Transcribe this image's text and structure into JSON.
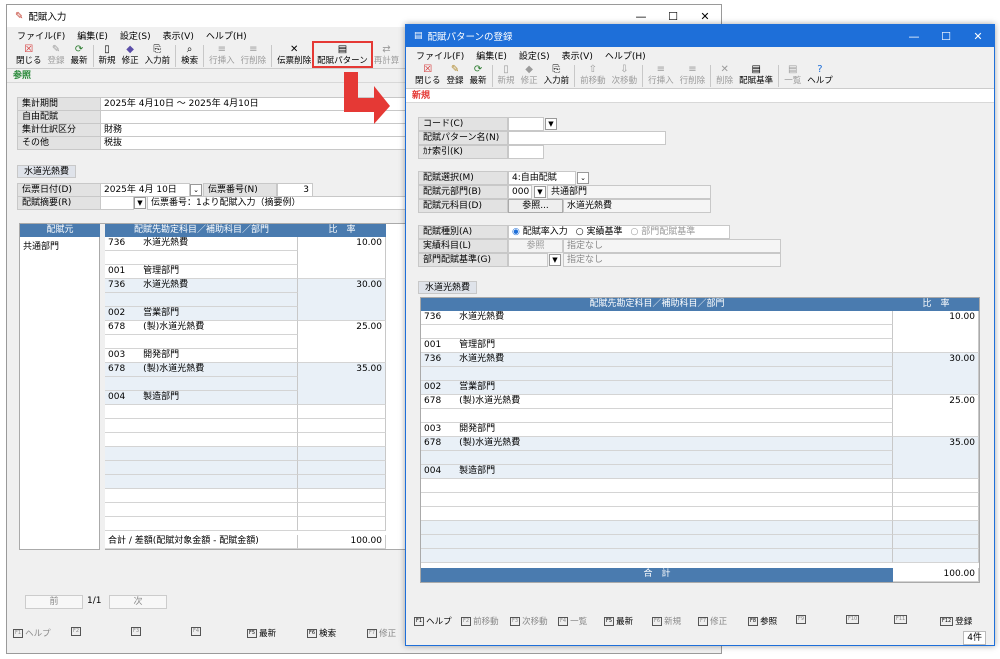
{
  "main": {
    "title": "配賦入力",
    "menu": [
      "ファイル(F)",
      "編集(E)",
      "設定(S)",
      "表示(V)",
      "ヘルプ(H)"
    ],
    "toolbar": [
      "閉じる",
      "登録",
      "最新",
      "新規",
      "修正",
      "入力前",
      "検索",
      "行挿入",
      "行削除",
      "伝票削除",
      "配賦パターン",
      "再計算"
    ],
    "mode": "参照",
    "info": [
      {
        "label": "集計期間",
        "value": "2025年 4月10日 〜 2025年 4月10日"
      },
      {
        "label": "自由配賦",
        "value": ""
      },
      {
        "label": "集計仕訳区分",
        "value": "財務"
      },
      {
        "label": "その他",
        "value": "税抜"
      }
    ],
    "section_tab": "水道光熱費",
    "date_label": "伝票日付(D)",
    "date_value": "2025年  4月 10日",
    "voucher_label": "伝票番号(N)",
    "voucher_value": "3",
    "memo_label": "配賦摘要(R)",
    "memo_value": "伝票番号：1より配賦入力（摘要例）",
    "left_header": "配賦元",
    "left_value": "共通部門",
    "grid_header_account": "配賦先勘定科目／補助科目／部門",
    "grid_header_rate": "比　率",
    "total_label": "合計 / 差額(配賦対象金額 - 配賦金額)",
    "total_value": "100.00",
    "pager_prev": "前",
    "pager_page": "1/1",
    "pager_next": "次",
    "fkeys": [
      "ヘルプ",
      "",
      "",
      "",
      "最新",
      "検索",
      "修正"
    ]
  },
  "rows": [
    {
      "code": "736",
      "name": "水道光熱費",
      "dept_code": "001",
      "dept": "管理部門",
      "rate": "10.00"
    },
    {
      "code": "736",
      "name": "水道光熱費",
      "dept_code": "002",
      "dept": "営業部門",
      "rate": "30.00"
    },
    {
      "code": "678",
      "name": "(製)水道光熱費",
      "dept_code": "003",
      "dept": "開発部門",
      "rate": "25.00"
    },
    {
      "code": "678",
      "name": "(製)水道光熱費",
      "dept_code": "004",
      "dept": "製造部門",
      "rate": "35.00"
    }
  ],
  "dialog": {
    "title": "配賦パターンの登録",
    "menu": [
      "ファイル(F)",
      "編集(E)",
      "設定(S)",
      "表示(V)",
      "ヘルプ(H)"
    ],
    "toolbar": [
      "閉じる",
      "登録",
      "最新",
      "新規",
      "修正",
      "入力前",
      "前移動",
      "次移動",
      "行挿入",
      "行削除",
      "削除",
      "配賦基準",
      "一覧",
      "ヘルプ"
    ],
    "mode": "新規",
    "code_label": "コード(C)",
    "name_label": "配賦パターン名(N)",
    "kana_label": "ｶﾅ索引(K)",
    "select_label": "配賦選択(M)",
    "select_value": "4:自由配賦",
    "src_dept_label": "配賦元部門(B)",
    "src_dept_code": "000",
    "src_dept_name": "共通部門",
    "src_acct_label": "配賦元科目(D)",
    "src_acct_btn": "参照...",
    "src_acct_value": "水道光熱費",
    "kind_label": "配賦種別(A)",
    "kind_options": [
      "配賦率入力",
      "実績基準",
      "部門配賦基準"
    ],
    "actual_label": "実績科目(L)",
    "actual_btn": "参照",
    "actual_value": "指定なし",
    "dept_basis_label": "部門配賦基準(G)",
    "dept_basis_value": "指定なし",
    "section_tab": "水道光熱費",
    "grid_header_account": "配賦先勘定科目／補助科目／部門",
    "grid_header_rate": "比　率",
    "total_label": "合　計",
    "total_value": "100.00",
    "fkeys": [
      "ヘルプ",
      "前移動",
      "次移動",
      "一覧",
      "最新",
      "新規",
      "修正",
      "参照",
      "",
      "",
      "",
      "登録"
    ],
    "count": "4件"
  },
  "colors": {
    "accent": "#e53935",
    "header_blue": "#4a7baf",
    "title_blue": "#1e6fd9"
  }
}
